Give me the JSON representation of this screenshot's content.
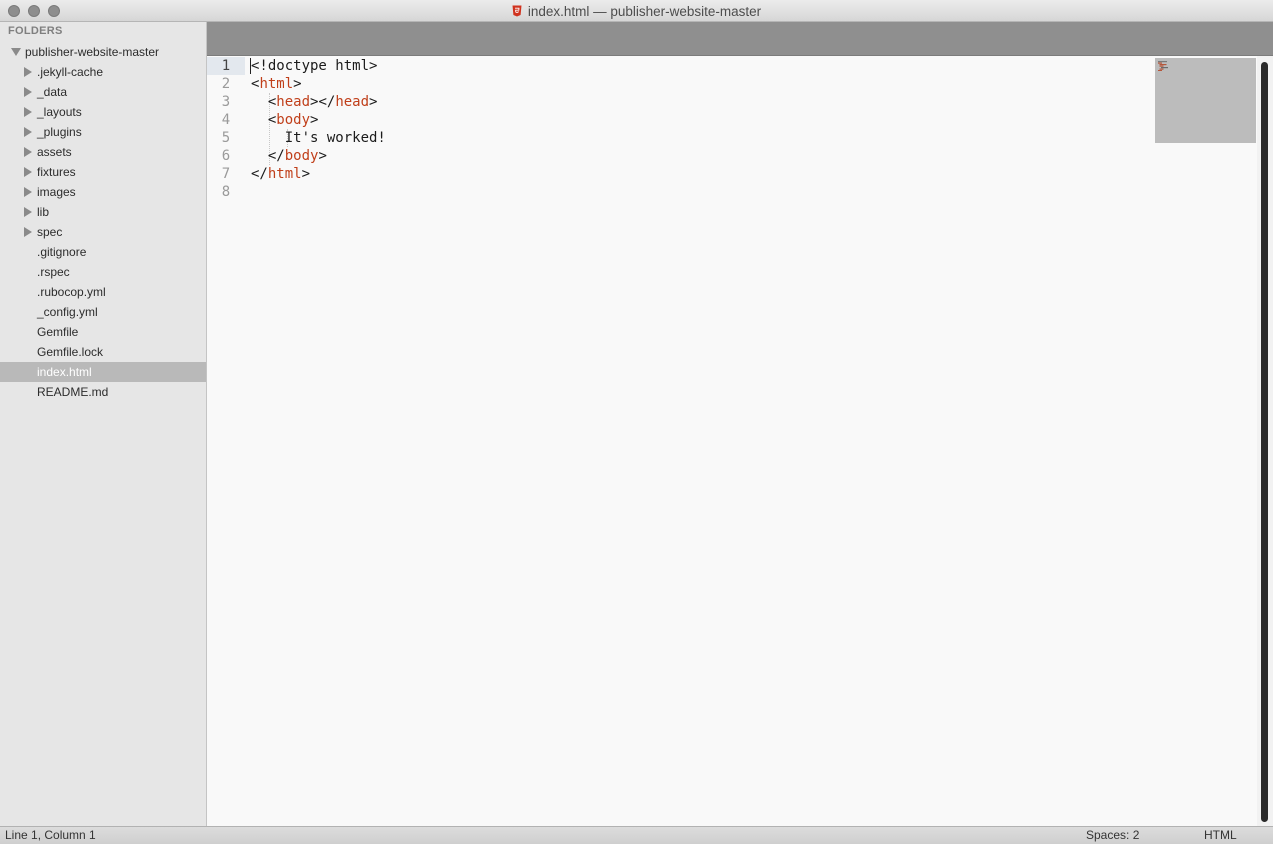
{
  "window": {
    "title": "index.html — publisher-website-master",
    "file_icon": "html-file-icon",
    "icon_color": "#d0321e"
  },
  "sidebar": {
    "header": "FOLDERS",
    "root": {
      "label": "publisher-website-master",
      "expanded": true
    },
    "folders": [
      {
        "label": ".jekyll-cache"
      },
      {
        "label": "_data"
      },
      {
        "label": "_layouts"
      },
      {
        "label": "_plugins"
      },
      {
        "label": "assets"
      },
      {
        "label": "fixtures"
      },
      {
        "label": "images"
      },
      {
        "label": "lib"
      },
      {
        "label": "spec"
      }
    ],
    "files": [
      {
        "label": ".gitignore"
      },
      {
        "label": ".rspec"
      },
      {
        "label": ".rubocop.yml"
      },
      {
        "label": "_config.yml"
      },
      {
        "label": "Gemfile"
      },
      {
        "label": "Gemfile.lock"
      },
      {
        "label": "index.html",
        "selected": true
      },
      {
        "label": "README.md"
      }
    ]
  },
  "editor": {
    "line_numbers": [
      "1",
      "2",
      "3",
      "4",
      "5",
      "6",
      "7",
      "8"
    ],
    "current_line": "1",
    "tag_color": "#c03f1a",
    "lines": [
      {
        "indent": "",
        "pre": "<!doctype html>",
        "tag": "",
        "post": ""
      },
      {
        "indent": "",
        "pre": "<",
        "tag": "html",
        "post": ">"
      },
      {
        "indent": "  ",
        "pre": "<",
        "tag": "head",
        "post": "></",
        "tag2": "head",
        "post2": ">"
      },
      {
        "indent": "  ",
        "pre": "<",
        "tag": "body",
        "post": ">"
      },
      {
        "indent": "    ",
        "pre": "It's worked!",
        "tag": "",
        "post": ""
      },
      {
        "indent": "  ",
        "pre": "</",
        "tag": "body",
        "post": ">"
      },
      {
        "indent": "",
        "pre": "</",
        "tag": "html",
        "post": ">"
      },
      {
        "indent": "",
        "pre": "",
        "tag": "",
        "post": ""
      }
    ]
  },
  "statusbar": {
    "position": "Line 1, Column 1",
    "indentation": "Spaces: 2",
    "syntax": "HTML"
  }
}
